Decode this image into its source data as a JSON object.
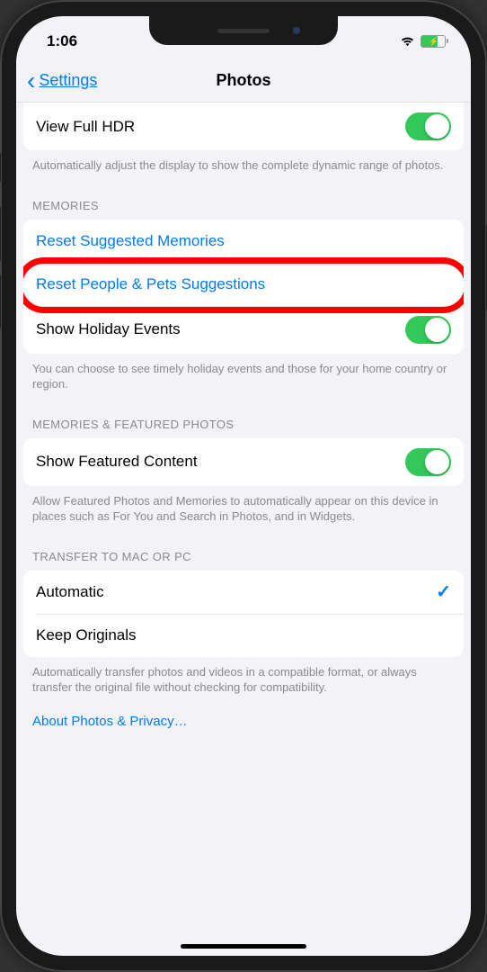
{
  "status": {
    "time": "1:06"
  },
  "nav": {
    "back": "Settings",
    "title": "Photos"
  },
  "hdr": {
    "label": "View Full HDR",
    "on": true,
    "footer": "Automatically adjust the display to show the complete dynamic range of photos."
  },
  "memories": {
    "header": "MEMORIES",
    "reset_memories": "Reset Suggested Memories",
    "reset_people": "Reset People & Pets Suggestions",
    "holiday_label": "Show Holiday Events",
    "holiday_on": true,
    "footer": "You can choose to see timely holiday events and those for your home country or region."
  },
  "featured": {
    "header": "MEMORIES & FEATURED PHOTOS",
    "label": "Show Featured Content",
    "on": true,
    "footer": "Allow Featured Photos and Memories to automatically appear on this device in places such as For You and Search in Photos, and in Widgets."
  },
  "transfer": {
    "header": "TRANSFER TO MAC OR PC",
    "automatic": "Automatic",
    "keep_originals": "Keep Originals",
    "selected": "automatic",
    "footer": "Automatically transfer photos and videos in a compatible format, or always transfer the original file without checking for compatibility."
  },
  "about_link": "About Photos & Privacy…"
}
